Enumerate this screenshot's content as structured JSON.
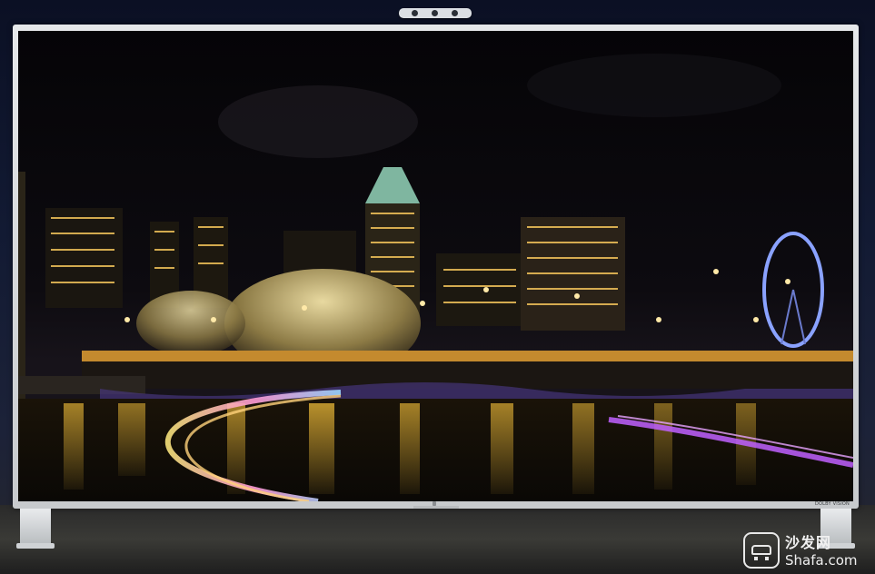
{
  "screen": {
    "description_colors": {
      "sky": "#07060a",
      "gold": "#f2b631",
      "purple": "#b050e0",
      "blue": "#6a8cff"
    }
  },
  "badge": {
    "text": "DOLBY VISION"
  },
  "watermark": {
    "title": "沙发网",
    "url": "Shafa.com"
  }
}
